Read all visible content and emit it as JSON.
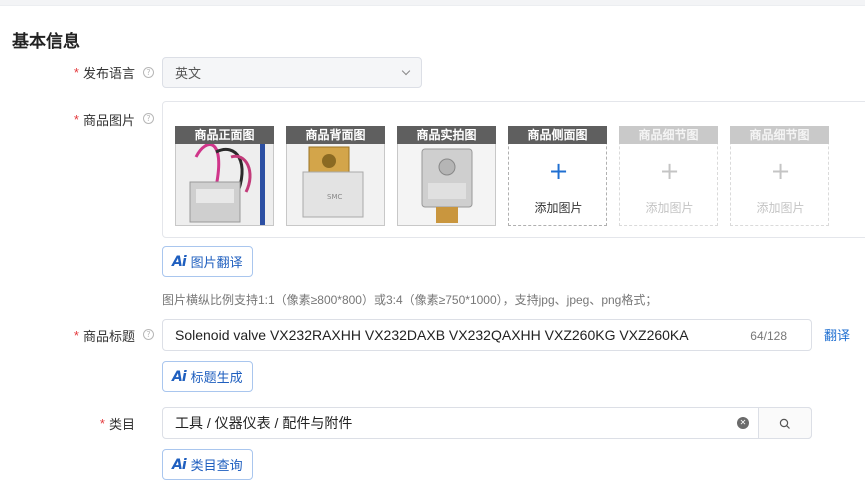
{
  "section_title": "基本信息",
  "language": {
    "label": "发布语言",
    "required": "*",
    "help": "?",
    "value": "英文"
  },
  "images": {
    "label": "商品图片",
    "required": "*",
    "help": "?",
    "slots": [
      {
        "tag": "商品正面图"
      },
      {
        "tag": "商品背面图"
      },
      {
        "tag": "商品实拍图"
      },
      {
        "tag": "商品侧面图",
        "add": "添加图片"
      },
      {
        "tag": "商品细节图",
        "add": "添加图片"
      },
      {
        "tag": "商品细节图",
        "add": "添加图片"
      }
    ],
    "ai_button": "图片翻译",
    "hint": "图片横纵比例支持1:1（像素≥800*800）或3:4（像素≥750*1000），支持jpg、jpeg、png格式；"
  },
  "title": {
    "label": "商品标题",
    "required": "*",
    "help": "?",
    "value": "Solenoid valve VX232RAXHH VX232DAXB VX232QAXHH VXZ260KG VXZ260KA",
    "counter": "64/128",
    "translate": "翻译",
    "ai_button": "标题生成"
  },
  "category": {
    "label": "类目",
    "required": "*",
    "value": "工具 / 仪器仪表 / 配件与附件",
    "ai_button": "类目查询"
  },
  "ai_icon_text": "Ai",
  "colors": {
    "accent": "#1f6fd1",
    "required": "#e4393c",
    "tag_bg": "#5f5f5f"
  }
}
